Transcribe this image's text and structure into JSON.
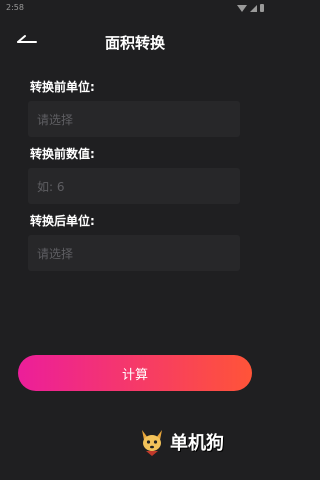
{
  "status_bar": {
    "time": "2:58"
  },
  "header": {
    "title": "面积转换",
    "back_icon": "back-arrow-icon"
  },
  "form": {
    "from_unit": {
      "label": "转换前单位:",
      "placeholder": "请选择"
    },
    "from_value": {
      "label": "转换前数值:",
      "placeholder": "如: 6"
    },
    "to_unit": {
      "label": "转换后单位:",
      "placeholder": "请选择"
    }
  },
  "actions": {
    "calculate_label": "计算"
  },
  "watermark": {
    "text": "单机狗"
  },
  "colors": {
    "background": "#1f1f21",
    "field_background": "#272729",
    "placeholder": "#5e5e62",
    "button_gradient_start": "#ec1e9a",
    "button_gradient_end": "#ff5438"
  }
}
